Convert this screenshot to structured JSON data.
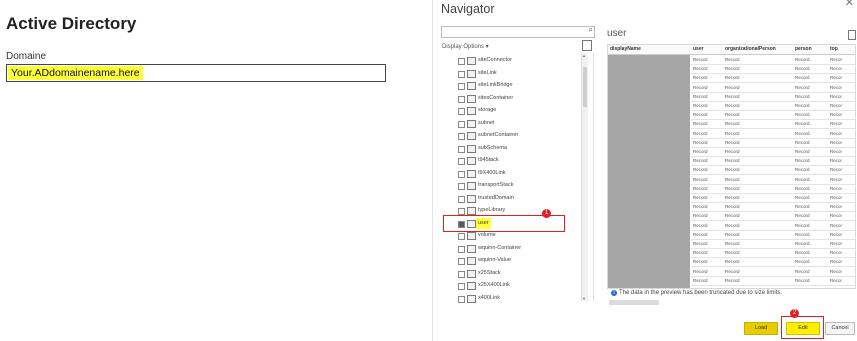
{
  "active_directory": {
    "title": "Active Directory",
    "domain_label": "Domaine",
    "domain_value": "Your.ADdomainename.here"
  },
  "navigator": {
    "title": "Navigator",
    "display_options": "Display Options ▾",
    "items": [
      {
        "label": "siteConnector",
        "checked": false
      },
      {
        "label": "siteLink",
        "checked": false
      },
      {
        "label": "siteLinkBridge",
        "checked": false
      },
      {
        "label": "sitesContainer",
        "checked": false
      },
      {
        "label": "storage",
        "checked": false
      },
      {
        "label": "subnet",
        "checked": false
      },
      {
        "label": "subnetContainer",
        "checked": false
      },
      {
        "label": "subSchema",
        "checked": false
      },
      {
        "label": "t945tack",
        "checked": false
      },
      {
        "label": "t9X400Link",
        "checked": false
      },
      {
        "label": "transportStack",
        "checked": false
      },
      {
        "label": "trustedDomain",
        "checked": false
      },
      {
        "label": "typeLibrary",
        "checked": false
      },
      {
        "label": "user",
        "checked": true
      },
      {
        "label": "volume",
        "checked": false
      },
      {
        "label": "wquinn-Container",
        "checked": false
      },
      {
        "label": "wquinn-Value",
        "checked": false
      },
      {
        "label": "x25Stack",
        "checked": false
      },
      {
        "label": "x25X400Link",
        "checked": false
      },
      {
        "label": "x400Link",
        "checked": false
      }
    ],
    "badge_1": "1",
    "badge_2": "2"
  },
  "preview": {
    "title": "user",
    "columns": [
      "displayName",
      "user",
      "organizationalPerson",
      "person",
      "top"
    ],
    "cell_value": "Record",
    "cell_value_truncated": "Recor",
    "row_count": 25,
    "info_text": "The data in the preview has been truncated due to size limits."
  },
  "buttons": {
    "load": "Load",
    "edit": "Edit",
    "cancel": "Cancel"
  },
  "colors": {
    "highlight": "#ffff3a",
    "annotation_red": "#e02020"
  }
}
